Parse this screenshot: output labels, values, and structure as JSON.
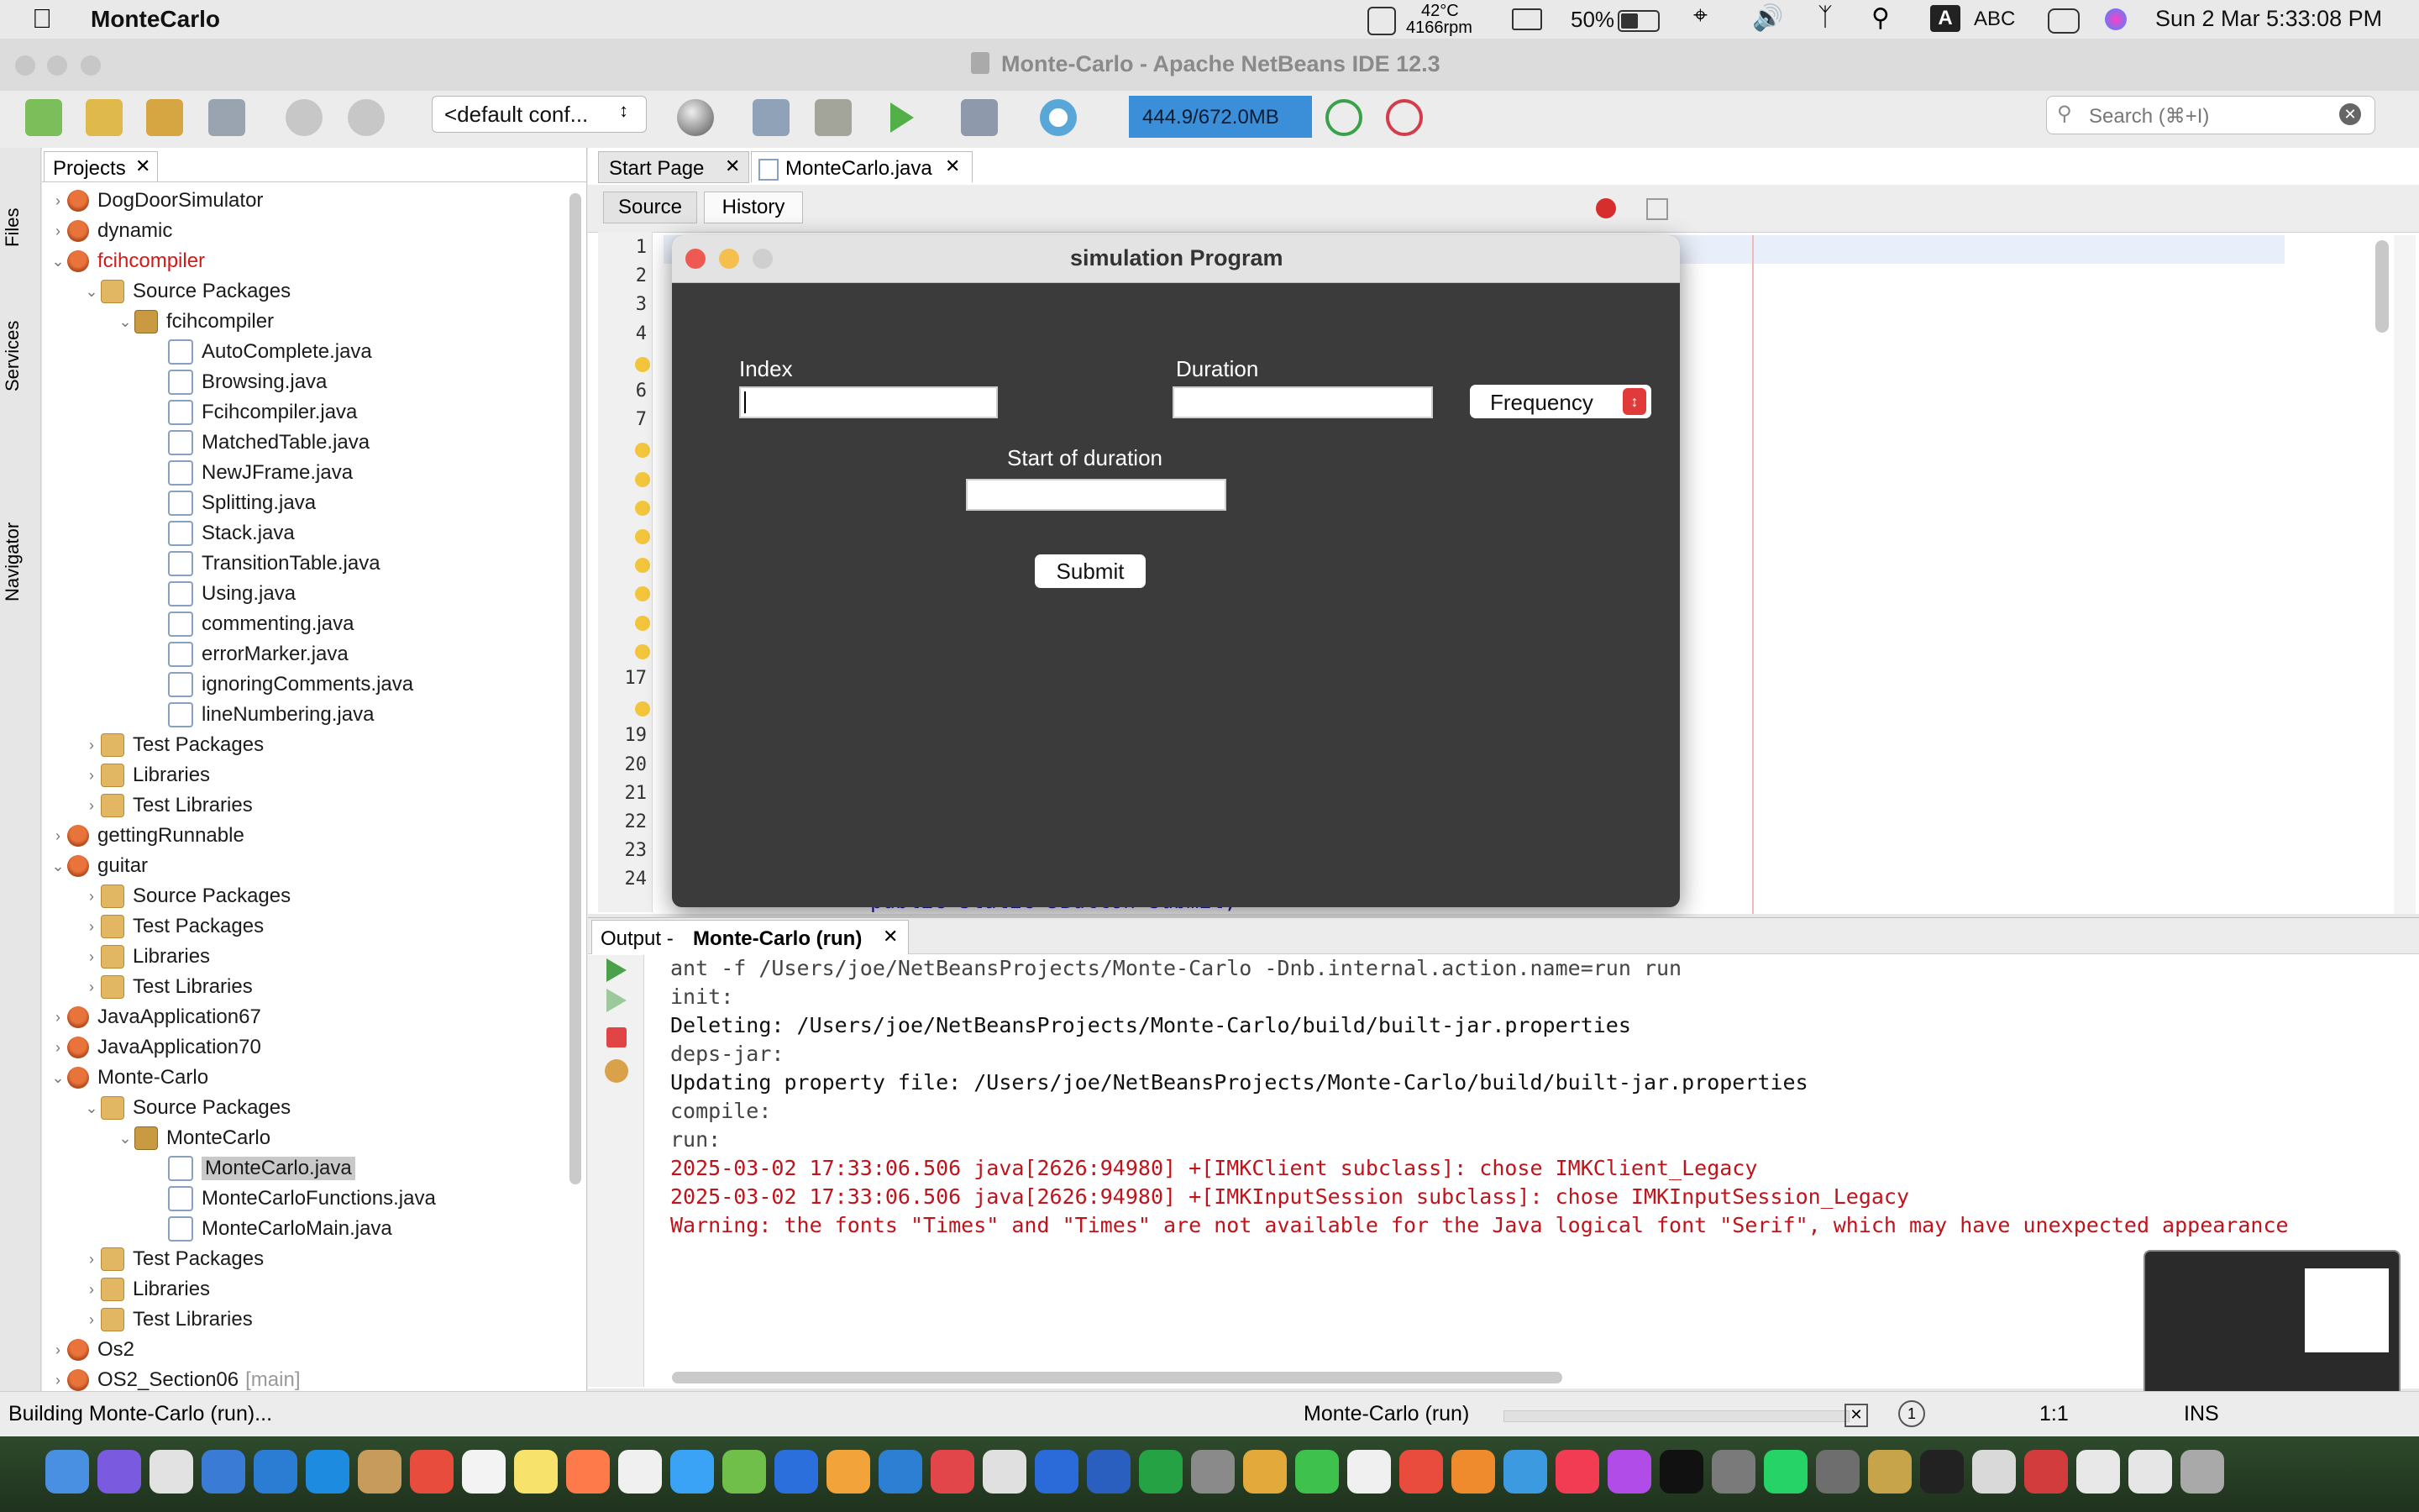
{
  "menubar": {
    "app_name": "MonteCarlo",
    "temp": "42°C",
    "rpm": "4166rpm",
    "battery": "50%",
    "input_a": "A",
    "input_lang": "ABC",
    "datetime": "Sun 2 Mar  5:33:08 PM"
  },
  "window": {
    "title": "Monte-Carlo - Apache NetBeans IDE 12.3"
  },
  "toolbar": {
    "config": "<default conf...",
    "memory": "444.9/672.0MB",
    "search_placeholder": "Search (⌘+I)"
  },
  "left_strip": {
    "files": "Files",
    "services": "Services",
    "navigator": "Navigator"
  },
  "projects": {
    "tab_label": "Projects",
    "items": [
      {
        "label": "DogDoorSimulator",
        "type": "proj",
        "indent": 0,
        "exp": "›"
      },
      {
        "label": "dynamic",
        "type": "proj",
        "indent": 0,
        "exp": "›"
      },
      {
        "label": "fcihcompiler",
        "type": "proj",
        "indent": 0,
        "exp": "⌄",
        "red": true
      },
      {
        "label": "Source Packages",
        "type": "pkg",
        "indent": 1,
        "exp": "⌄"
      },
      {
        "label": "fcihcompiler",
        "type": "pkgmain",
        "indent": 2,
        "exp": "⌄"
      },
      {
        "label": "AutoComplete.java",
        "type": "java",
        "indent": 3,
        "exp": ""
      },
      {
        "label": "Browsing.java",
        "type": "java",
        "indent": 3,
        "exp": ""
      },
      {
        "label": "Fcihcompiler.java",
        "type": "java",
        "indent": 3,
        "exp": ""
      },
      {
        "label": "MatchedTable.java",
        "type": "java",
        "indent": 3,
        "exp": ""
      },
      {
        "label": "NewJFrame.java",
        "type": "java",
        "indent": 3,
        "exp": ""
      },
      {
        "label": "Splitting.java",
        "type": "java",
        "indent": 3,
        "exp": ""
      },
      {
        "label": "Stack.java",
        "type": "java",
        "indent": 3,
        "exp": ""
      },
      {
        "label": "TransitionTable.java",
        "type": "java",
        "indent": 3,
        "exp": ""
      },
      {
        "label": "Using.java",
        "type": "java",
        "indent": 3,
        "exp": ""
      },
      {
        "label": "commenting.java",
        "type": "java",
        "indent": 3,
        "exp": ""
      },
      {
        "label": "errorMarker.java",
        "type": "java",
        "indent": 3,
        "exp": ""
      },
      {
        "label": "ignoringComments.java",
        "type": "java",
        "indent": 3,
        "exp": ""
      },
      {
        "label": "lineNumbering.java",
        "type": "java",
        "indent": 3,
        "exp": ""
      },
      {
        "label": "Test Packages",
        "type": "pkg",
        "indent": 1,
        "exp": "›"
      },
      {
        "label": "Libraries",
        "type": "pkg",
        "indent": 1,
        "exp": "›"
      },
      {
        "label": "Test Libraries",
        "type": "pkg",
        "indent": 1,
        "exp": "›"
      },
      {
        "label": "gettingRunnable",
        "type": "proj",
        "indent": 0,
        "exp": "›"
      },
      {
        "label": "guitar",
        "type": "proj",
        "indent": 0,
        "exp": "⌄"
      },
      {
        "label": "Source Packages",
        "type": "pkg",
        "indent": 1,
        "exp": "›"
      },
      {
        "label": "Test Packages",
        "type": "pkg",
        "indent": 1,
        "exp": "›"
      },
      {
        "label": "Libraries",
        "type": "pkg",
        "indent": 1,
        "exp": "›"
      },
      {
        "label": "Test Libraries",
        "type": "pkg",
        "indent": 1,
        "exp": "›"
      },
      {
        "label": "JavaApplication67",
        "type": "proj",
        "indent": 0,
        "exp": "›"
      },
      {
        "label": "JavaApplication70",
        "type": "proj",
        "indent": 0,
        "exp": "›"
      },
      {
        "label": "Monte-Carlo",
        "type": "proj",
        "indent": 0,
        "exp": "⌄"
      },
      {
        "label": "Source Packages",
        "type": "pkg",
        "indent": 1,
        "exp": "⌄"
      },
      {
        "label": "MonteCarlo",
        "type": "pkgmain",
        "indent": 2,
        "exp": "⌄"
      },
      {
        "label": "MonteCarlo.java",
        "type": "java",
        "indent": 3,
        "exp": "",
        "selected": true
      },
      {
        "label": "MonteCarloFunctions.java",
        "type": "java",
        "indent": 3,
        "exp": ""
      },
      {
        "label": "MonteCarloMain.java",
        "type": "java",
        "indent": 3,
        "exp": ""
      },
      {
        "label": "Test Packages",
        "type": "pkg",
        "indent": 1,
        "exp": "›"
      },
      {
        "label": "Libraries",
        "type": "pkg",
        "indent": 1,
        "exp": "›"
      },
      {
        "label": "Test Libraries",
        "type": "pkg",
        "indent": 1,
        "exp": "›"
      },
      {
        "label": "Os2",
        "type": "proj",
        "indent": 0,
        "exp": "›"
      },
      {
        "label": "OS2_Section06",
        "type": "proj",
        "indent": 0,
        "exp": "›",
        "suffix": "[main]"
      }
    ]
  },
  "editor": {
    "tabs": [
      "Start Page",
      "MonteCarlo.java"
    ],
    "source_btn": "Source",
    "history_btn": "History",
    "line_numbers": [
      "1",
      "2",
      "3",
      "4",
      "",
      "6",
      "7",
      "",
      "",
      "",
      "",
      "",
      "",
      "",
      "",
      "17",
      "",
      "19",
      "20",
      "21",
      "22",
      "23",
      "24"
    ],
    "code_fragment": "public static JButton submit;"
  },
  "dialog": {
    "title": "simulation Program",
    "index_label": "Index",
    "duration_label": "Duration",
    "start_label": "Start of duration",
    "frequency_value": "Frequency",
    "submit_label": "Submit"
  },
  "output": {
    "tab_label_prefix": "Output - ",
    "tab_label_main": "Monte-Carlo (run)",
    "lines": [
      {
        "text": "ant -f /Users/joe/NetBeansProjects/Monte-Carlo -Dnb.internal.action.name=run run",
        "color": "#444444"
      },
      {
        "text": "init:",
        "color": "#444444"
      },
      {
        "text": "Deleting: /Users/joe/NetBeansProjects/Monte-Carlo/build/built-jar.properties",
        "color": "#111111"
      },
      {
        "text": "deps-jar:",
        "color": "#444444"
      },
      {
        "text": "Updating property file: /Users/joe/NetBeansProjects/Monte-Carlo/build/built-jar.properties",
        "color": "#111111"
      },
      {
        "text": "compile:",
        "color": "#444444"
      },
      {
        "text": "run:",
        "color": "#444444"
      },
      {
        "text": "2025-03-02 17:33:06.506 java[2626:94980] +[IMKClient subclass]: chose IMKClient_Legacy",
        "color": "#c0141c"
      },
      {
        "text": "2025-03-02 17:33:06.506 java[2626:94980] +[IMKInputSession subclass]: chose IMKInputSession_Legacy",
        "color": "#c0141c"
      },
      {
        "text": "Warning: the fonts \"Times\" and \"Times\" are not available for the Java logical font \"Serif\", which may have unexpected appearance",
        "color": "#c0141c"
      }
    ]
  },
  "status": {
    "left": "Building Monte-Carlo (run)...",
    "center": "Monte-Carlo (run)",
    "position": "1:1",
    "mode": "INS",
    "badge": "1"
  }
}
